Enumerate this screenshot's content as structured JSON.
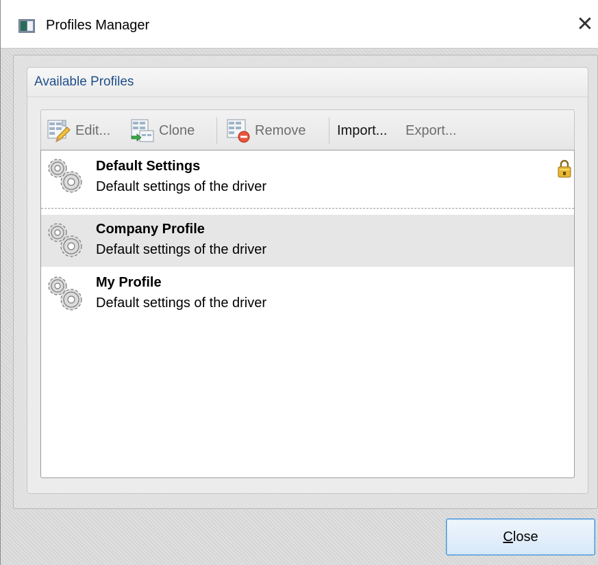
{
  "window": {
    "title": "Profiles Manager",
    "close_glyph": "✕"
  },
  "group": {
    "title": "Available Profiles"
  },
  "toolbar": {
    "edit_label": "Edit...",
    "clone_label": "Clone",
    "remove_label": "Remove",
    "import_label": "Import...",
    "export_label": "Export..."
  },
  "profiles": [
    {
      "name": "Default Settings",
      "description": "Default settings of the driver",
      "locked": true,
      "selected": false
    },
    {
      "name": "Company Profile",
      "description": "Default settings of the driver",
      "locked": false,
      "selected": true
    },
    {
      "name": "My Profile",
      "description": "Default settings of the driver",
      "locked": false,
      "selected": false
    }
  ],
  "footer": {
    "close_label_mnemonic": "C",
    "close_label_rest": "lose"
  },
  "colors": {
    "accent": "#1f4e8a",
    "button_border": "#3b8fd8",
    "selection": "#e6e6e6"
  },
  "icons": {
    "app": "profiles-app-icon",
    "edit": "edit-profile-icon",
    "clone": "clone-profile-icon",
    "remove": "remove-profile-icon",
    "profile": "gears-icon",
    "lock": "lock-icon"
  }
}
